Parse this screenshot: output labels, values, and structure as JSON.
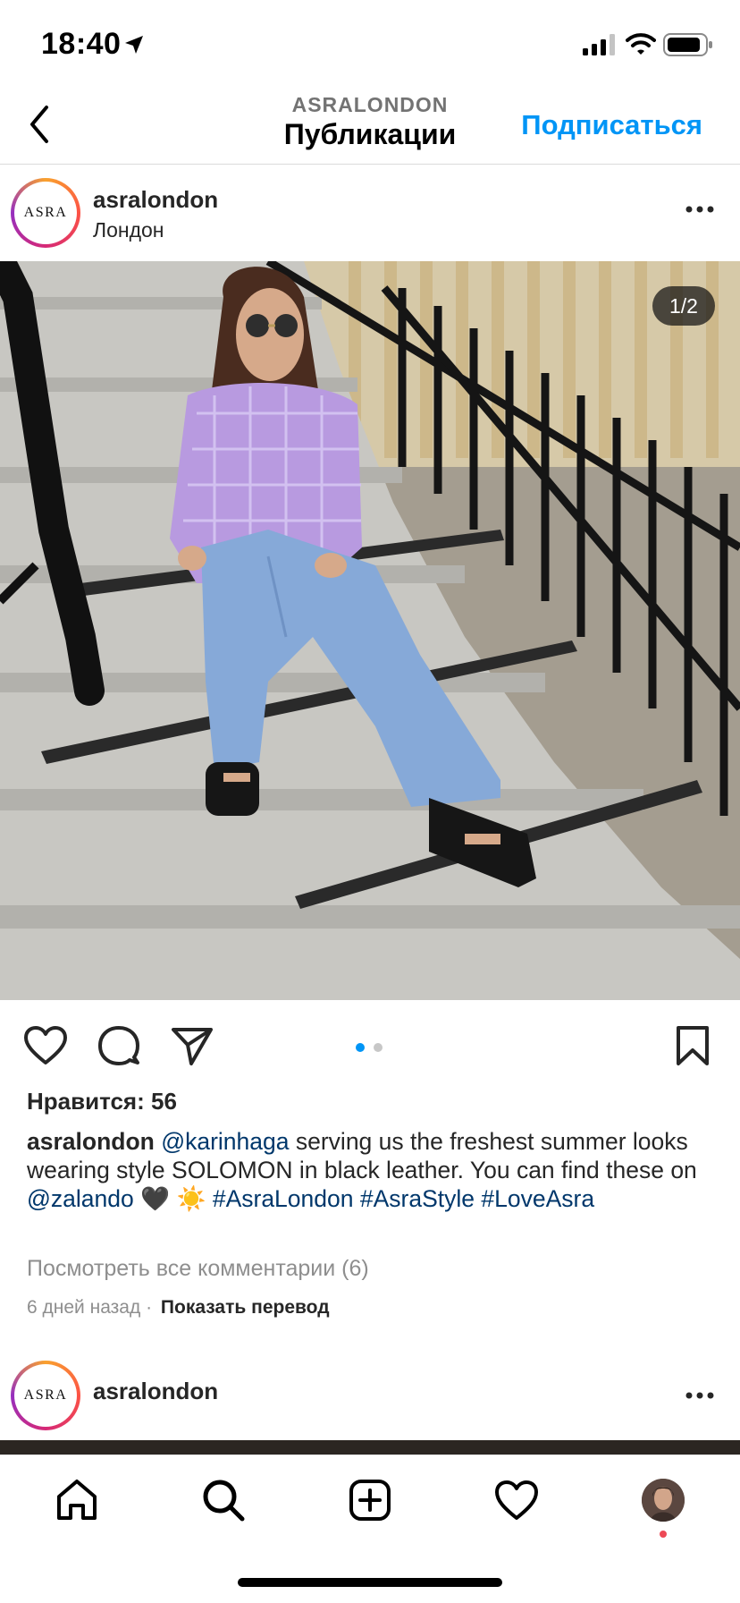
{
  "status_bar": {
    "time": "18:40",
    "icons": [
      "location-arrow-icon",
      "signal-icon",
      "wifi-icon",
      "battery-icon"
    ]
  },
  "header": {
    "subtitle": "ASRALONDON",
    "title": "Публикации",
    "follow_label": "Подписаться",
    "back_icon": "chevron-left-icon"
  },
  "post": {
    "avatar_text": "ASRA",
    "username": "asralondon",
    "location": "Лондон",
    "image_counter": "1/2",
    "likes": "Нравится: 56",
    "caption": {
      "username": "asralondon",
      "mention1": "@karinhaga",
      "text1": " serving us the freshest summer looks wearing style SOLOMON in black leather. You can find these on ",
      "mention2": "@zalando",
      "emoji": " 🖤 ☀️ ",
      "tag1": "#AsraLondon",
      "tag2": "#AsraStyle",
      "tag3": "#LoveAsra"
    },
    "view_comments": "Посмотреть все комментарии (6)",
    "time_ago": "6 дней назад",
    "separator": "·",
    "translate": "Показать перевод"
  },
  "next_post": {
    "avatar_text": "ASRA",
    "username": "asralondon"
  },
  "colors": {
    "accent": "#0095f6",
    "link": "#00376b",
    "muted": "#8e8e8e",
    "text": "#262626",
    "active_dot": "#0095f6",
    "inactive_dot": "#c7c7c7",
    "notification": "#ed4956"
  },
  "tabbar": {
    "items": [
      "home-icon",
      "search-icon",
      "new-post-icon",
      "activity-heart-icon",
      "profile-avatar"
    ]
  }
}
